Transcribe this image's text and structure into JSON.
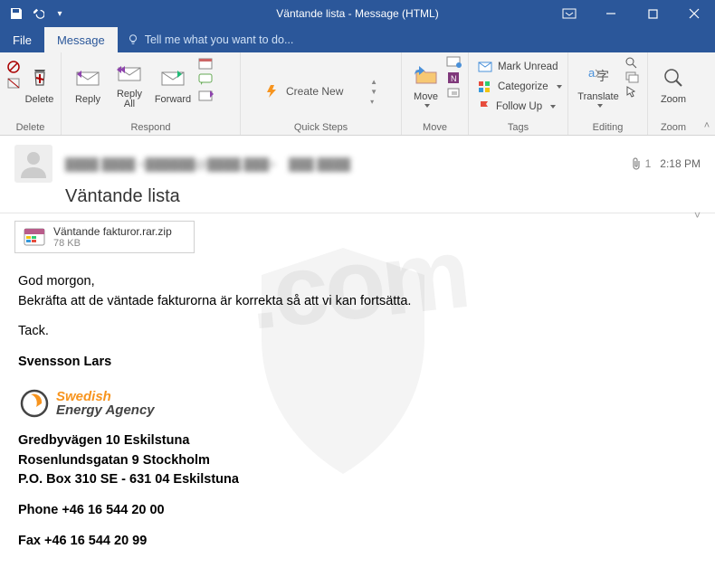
{
  "titlebar": {
    "title": "Väntande lista - Message (HTML)"
  },
  "menubar": {
    "file": "File",
    "message": "Message",
    "tellme": "Tell me what you want to do..."
  },
  "ribbon": {
    "delete": {
      "label": "Delete",
      "btn": "Delete"
    },
    "respond": {
      "label": "Respond",
      "reply": "Reply",
      "replyall": "Reply\nAll",
      "forward": "Forward"
    },
    "quicksteps": {
      "label": "Quick Steps",
      "createnew": "Create New"
    },
    "move": {
      "label": "Move",
      "move": "Move"
    },
    "tags": {
      "label": "Tags",
      "unread": "Mark Unread",
      "categorize": "Categorize",
      "followup": "Follow Up"
    },
    "editing": {
      "label": "Editing",
      "translate": "Translate"
    },
    "zoom": {
      "label": "Zoom",
      "zoom": "Zoom"
    }
  },
  "message": {
    "subject": "Väntande lista",
    "attach_count": "1",
    "time": "2:18 PM",
    "attachment": {
      "name": "Väntande fakturor.rar.zip",
      "size": "78 KB"
    }
  },
  "body": {
    "l1": "God morgon,",
    "l2": "Bekräfta att de väntade fakturorna är korrekta så att vi kan fortsätta.",
    "l3": "Tack.",
    "l4": "Svensson Lars",
    "logo1": "Swedish",
    "logo2": "Energy Agency",
    "addr1": "Gredbyvägen 10 Eskilstuna",
    "addr2": "Rosenlundsgatan 9 Stockholm",
    "addr3": "P.O. Box 310 SE - 631 04 Eskilstuna",
    "phone": "Phone +46 16 544 20 00",
    "fax": "Fax +46 16 544 20 99"
  },
  "watermark": ".com"
}
